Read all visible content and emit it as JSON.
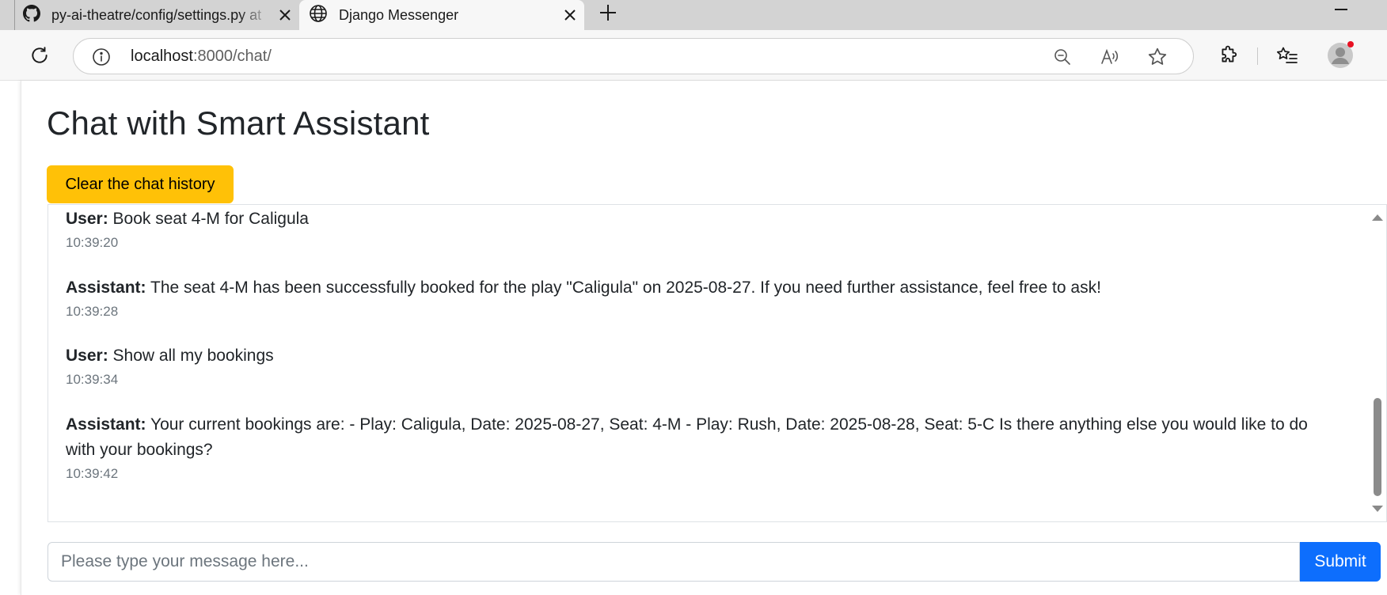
{
  "browser": {
    "tabs": [
      {
        "title": "py-ai-theatre/config/settings.py at",
        "icon": "github-icon"
      },
      {
        "title": "Django Messenger",
        "icon": "globe-icon"
      }
    ],
    "address": {
      "host": "localhost",
      "path": ":8000/chat/"
    }
  },
  "page": {
    "title": "Chat with Smart Assistant",
    "clear_button": "Clear the chat history",
    "messages": [
      {
        "sender": "User:",
        "text": " Book seat 4-M for Caligula",
        "time": "10:39:20"
      },
      {
        "sender": "Assistant:",
        "text": " The seat 4-M has been successfully booked for the play \"Caligula\" on 2025-08-27. If you need further assistance, feel free to ask!",
        "time": "10:39:28"
      },
      {
        "sender": "User:",
        "text": " Show all my bookings",
        "time": "10:39:34"
      },
      {
        "sender": "Assistant:",
        "text": " Your current bookings are: - Play: Caligula, Date: 2025-08-27, Seat: 4-M - Play: Rush, Date: 2025-08-28, Seat: 5-C Is there anything else you would like to do with your bookings?",
        "time": "10:39:42"
      }
    ],
    "input_placeholder": "Please type your message here...",
    "input_value": "",
    "submit_button": "Submit"
  },
  "colors": {
    "warning": "#ffc107",
    "primary": "#0d6efd",
    "muted_text": "#6c757d",
    "notification_dot": "#e81123"
  }
}
